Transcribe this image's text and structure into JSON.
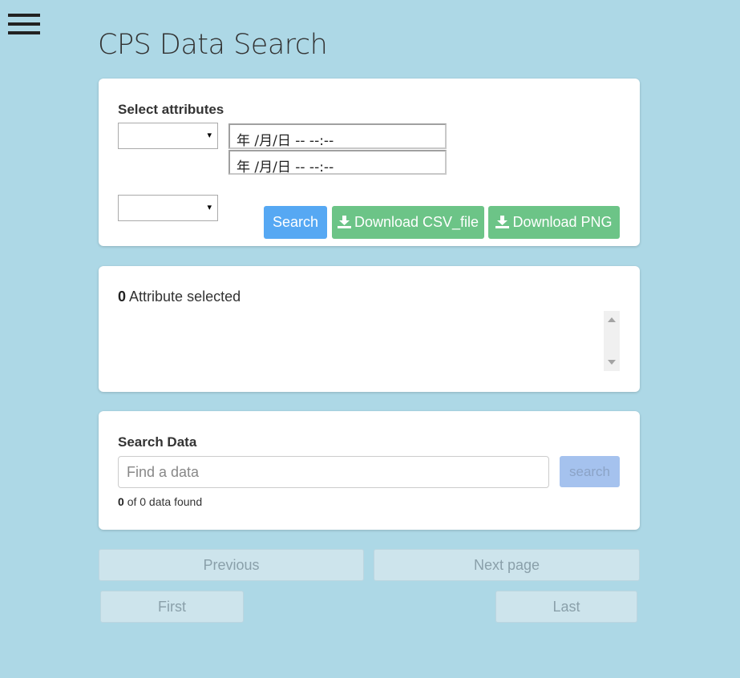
{
  "page": {
    "title": "CPS Data Search",
    "menu_icon": "hamburger-menu-icon"
  },
  "attributes_card": {
    "heading": "Select attributes",
    "select_1_value": "",
    "select_2_value": "",
    "select_arrow": "▾",
    "datetime_start": "年 /月/日  -- --:--",
    "datetime_end": "年 /月/日  -- --:--",
    "search_label": "Search",
    "download_csv_label": "Download CSV_file",
    "download_png_label": "Download PNG",
    "download_icon": "download-icon"
  },
  "selected_card": {
    "count": "0",
    "text": "Attribute selected"
  },
  "search_data_card": {
    "heading": "Search Data",
    "input_value": "",
    "input_placeholder": "Find a data",
    "button_label": "search",
    "found_count": "0",
    "found_text": "of 0 data found"
  },
  "pagination": {
    "previous_label": "Previous",
    "next_label": "Next page",
    "first_label": "First",
    "last_label": "Last"
  },
  "colors": {
    "background": "#add8e6",
    "primary_button": "#56a8f3",
    "success_button": "#6cc487",
    "disabled_search": "#a5c2ee"
  }
}
